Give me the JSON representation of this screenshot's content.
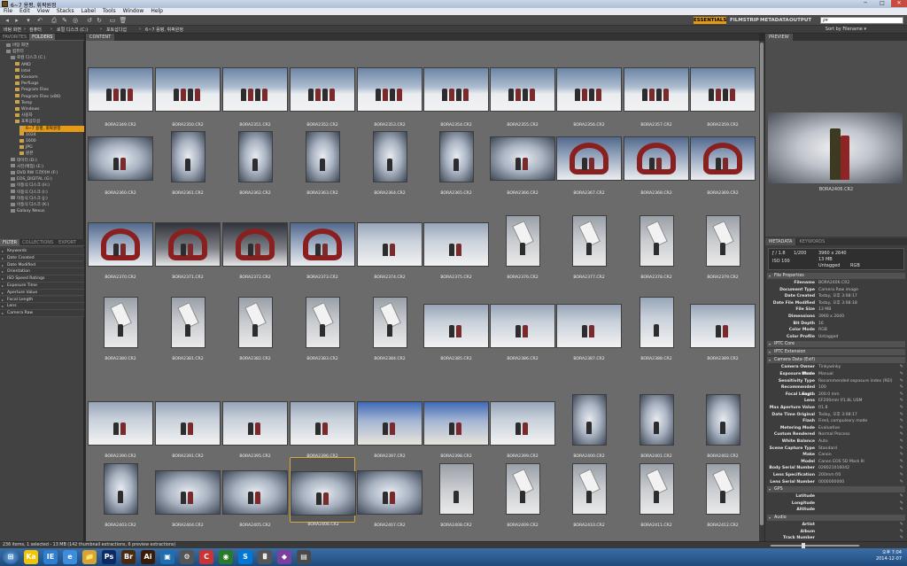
{
  "window": {
    "title": "6~7 용평, 휘팍원정",
    "controls": [
      "─",
      "□",
      "✕"
    ]
  },
  "menu": [
    "File",
    "Edit",
    "View",
    "Stacks",
    "Label",
    "Tools",
    "Window",
    "Help"
  ],
  "workspaces": [
    "ESSENTIALS",
    "FILMSTRIP",
    "METADATA",
    "OUTPUT"
  ],
  "search": {
    "placeholder": "ρ▾"
  },
  "path": [
    "바탕 화면",
    "컴퓨터",
    "로컬 디스크 (C:)",
    "포토삽다섭",
    "6~7 용평, 휘팍원정"
  ],
  "sort": "Sort by Filename ▾",
  "left_tabs": [
    "FAVORITES",
    "FOLDERS"
  ],
  "folders": [
    {
      "label": "바탕 화면",
      "indent": 1,
      "icon": "desktop"
    },
    {
      "label": "컴퓨터",
      "indent": 1,
      "icon": "drive"
    },
    {
      "label": "로컬 디스크 (C:)",
      "indent": 2,
      "icon": "drive"
    },
    {
      "label": "AMD",
      "indent": 3,
      "icon": "folder"
    },
    {
      "label": "Intel",
      "indent": 3,
      "icon": "folder"
    },
    {
      "label": "Kavoom",
      "indent": 3,
      "icon": "folder"
    },
    {
      "label": "PerfLogs",
      "indent": 3,
      "icon": "folder"
    },
    {
      "label": "Program Files",
      "indent": 3,
      "icon": "folder"
    },
    {
      "label": "Program Files (x86)",
      "indent": 3,
      "icon": "folder"
    },
    {
      "label": "Temp",
      "indent": 3,
      "icon": "folder"
    },
    {
      "label": "Windows",
      "indent": 3,
      "icon": "folder"
    },
    {
      "label": "사용자",
      "indent": 3,
      "icon": "folder"
    },
    {
      "label": "포토삽다섭",
      "indent": 3,
      "icon": "folder"
    },
    {
      "label": "6~7 용평, 휘팍원정",
      "indent": 4,
      "icon": "folder",
      "selected": true
    },
    {
      "label": "1024",
      "indent": 4,
      "icon": "folder"
    },
    {
      "label": "1600",
      "indent": 4,
      "icon": "folder"
    },
    {
      "label": "JPG",
      "indent": 4,
      "icon": "folder"
    },
    {
      "label": "원본",
      "indent": 4,
      "icon": "folder"
    },
    {
      "label": "데이터 (D:)",
      "indent": 2,
      "icon": "drive"
    },
    {
      "label": "사진(백업) (E:)",
      "indent": 2,
      "icon": "drive"
    },
    {
      "label": "DVD RW 드라이브 (F:)",
      "indent": 2,
      "icon": "drive"
    },
    {
      "label": "EOS_DIGITAL (G:)",
      "indent": 2,
      "icon": "drive"
    },
    {
      "label": "이동식 디스크 (H:)",
      "indent": 2,
      "icon": "drive"
    },
    {
      "label": "이동식 디스크 (I:)",
      "indent": 2,
      "icon": "drive"
    },
    {
      "label": "이동식 디스크 (J:)",
      "indent": 2,
      "icon": "drive"
    },
    {
      "label": "이동식 디스크 (K:)",
      "indent": 2,
      "icon": "drive"
    },
    {
      "label": "Galaxy Nexus",
      "indent": 2,
      "icon": "drive"
    }
  ],
  "filter_tabs": [
    "FILTER",
    "COLLECTIONS",
    "EXPORT"
  ],
  "filters": [
    "Keywords",
    "Date Created",
    "Date Modified",
    "Orientation",
    "ISO Speed Ratings",
    "Exposure Time",
    "Aperture Value",
    "Focal Length",
    "Lens",
    "Camera Raw"
  ],
  "content_tab": "CONTENT",
  "thumbnails": [
    {
      "name": "BORA2349.CR2",
      "o": "l",
      "s": "sky"
    },
    {
      "name": "BORA2350.CR2",
      "o": "l",
      "s": "sky"
    },
    {
      "name": "BORA2351.CR2",
      "o": "l",
      "s": "sky"
    },
    {
      "name": "BORA2352.CR2",
      "o": "l",
      "s": "sky"
    },
    {
      "name": "BORA2353.CR2",
      "o": "l",
      "s": "sky"
    },
    {
      "name": "BORA2354.CR2",
      "o": "l",
      "s": "sky"
    },
    {
      "name": "BORA2355.CR2",
      "o": "l",
      "s": "sky"
    },
    {
      "name": "BORA2356.CR2",
      "o": "l",
      "s": "sky"
    },
    {
      "name": "BORA2357.CR2",
      "o": "l",
      "s": "sky"
    },
    {
      "name": "BORA2359.CR2",
      "o": "l",
      "s": "sky"
    },
    {
      "name": "BORA2360.CR2",
      "o": "l",
      "s": "vig"
    },
    {
      "name": "BORA2361.CR2",
      "o": "p",
      "s": "vig"
    },
    {
      "name": "BORA2362.CR2",
      "o": "p",
      "s": "vig"
    },
    {
      "name": "BORA2363.CR2",
      "o": "p",
      "s": "vig"
    },
    {
      "name": "BORA2364.CR2",
      "o": "p",
      "s": "vig"
    },
    {
      "name": "BORA2365.CR2",
      "o": "p",
      "s": "vig"
    },
    {
      "name": "BORA2366.CR2",
      "o": "l",
      "s": "vig"
    },
    {
      "name": "BORA2367.CR2",
      "o": "l",
      "s": "red",
      "h": true
    },
    {
      "name": "BORA2368.CR2",
      "o": "l",
      "s": "red",
      "h": true
    },
    {
      "name": "BORA2369.CR2",
      "o": "l",
      "s": "red",
      "h": true
    },
    {
      "name": "BORA2370.CR2",
      "o": "l",
      "s": "red",
      "h": true
    },
    {
      "name": "BORA2371.CR2",
      "o": "l",
      "s": "dark",
      "h": true
    },
    {
      "name": "BORA2372.CR2",
      "o": "l",
      "s": "dark",
      "h": true
    },
    {
      "name": "BORA2373.CR2",
      "o": "l",
      "s": "red",
      "h": true
    },
    {
      "name": "BORA2374.CR2",
      "o": "l",
      "s": "snow"
    },
    {
      "name": "BORA2375.CR2",
      "o": "l",
      "s": "snow"
    },
    {
      "name": "BORA2376.CR2",
      "o": "p",
      "s": "grey",
      "c": true
    },
    {
      "name": "BORA2377.CR2",
      "o": "p",
      "s": "grey",
      "c": true
    },
    {
      "name": "BORA2378.CR2",
      "o": "p",
      "s": "grey",
      "c": true
    },
    {
      "name": "BORA2379.CR2",
      "o": "p",
      "s": "grey",
      "c": true
    },
    {
      "name": "BORA2380.CR2",
      "o": "p",
      "s": "grey",
      "c": true
    },
    {
      "name": "BORA2381.CR2",
      "o": "p",
      "s": "grey",
      "c": true
    },
    {
      "name": "BORA2382.CR2",
      "o": "p",
      "s": "grey",
      "c": true
    },
    {
      "name": "BORA2383.CR2",
      "o": "p",
      "s": "grey",
      "c": true
    },
    {
      "name": "BORA2384.CR2",
      "o": "p",
      "s": "grey",
      "c": true
    },
    {
      "name": "BORA2385.CR2",
      "o": "l",
      "s": "snow"
    },
    {
      "name": "BORA2386.CR2",
      "o": "l",
      "s": "snow"
    },
    {
      "name": "BORA2387.CR2",
      "o": "l",
      "s": "snow"
    },
    {
      "name": "BORA2388.CR2",
      "o": "p",
      "s": "snow"
    },
    {
      "name": "BORA2389.CR2",
      "o": "l",
      "s": "snow"
    },
    {
      "name": "BORA2390.CR2",
      "o": "l",
      "s": "snow"
    },
    {
      "name": "BORA2391.CR2",
      "o": "l",
      "s": "snow"
    },
    {
      "name": "BORA2395.CR2",
      "o": "l",
      "s": "snow"
    },
    {
      "name": "BORA2396.CR2",
      "o": "l",
      "s": "snow"
    },
    {
      "name": "BORA2397.CR2",
      "o": "l",
      "s": "bld"
    },
    {
      "name": "BORA2398.CR2",
      "o": "l",
      "s": "bld"
    },
    {
      "name": "BORA2399.CR2",
      "o": "l",
      "s": "snow"
    },
    {
      "name": "BORA2400.CR2",
      "o": "v",
      "s": "vig"
    },
    {
      "name": "BORA2401.CR2",
      "o": "v",
      "s": "vig"
    },
    {
      "name": "BORA2402.CR2",
      "o": "v",
      "s": "vig"
    },
    {
      "name": "BORA2403.CR2",
      "o": "v",
      "s": "vig"
    },
    {
      "name": "BORA2404.CR2",
      "o": "l",
      "s": "vig"
    },
    {
      "name": "BORA2405.CR2",
      "o": "l",
      "s": "vig"
    },
    {
      "name": "BORA2406.CR2",
      "o": "l",
      "s": "vig",
      "selected": true
    },
    {
      "name": "BORA2407.CR2",
      "o": "l",
      "s": "vig"
    },
    {
      "name": "BORA2408.CR2",
      "o": "p",
      "s": "grey"
    },
    {
      "name": "BORA2409.CR2",
      "o": "p",
      "s": "grey",
      "c": true
    },
    {
      "name": "BORA2410.CR2",
      "o": "p",
      "s": "grey",
      "c": true
    },
    {
      "name": "BORA2411.CR2",
      "o": "p",
      "s": "grey",
      "c": true
    },
    {
      "name": "BORA2412.CR2",
      "o": "p",
      "s": "grey",
      "c": true
    }
  ],
  "preview": {
    "tab": "PREVIEW",
    "caption": "BORA2406.CR2"
  },
  "meta_tabs": [
    "METADATA",
    "KEYWORDS"
  ],
  "camera_box": {
    "aperture": "ƒ / 1.8",
    "shutter": "1/200",
    "dimensions": "3960 x 2640",
    "size": "13 MB",
    "label": "Untagged",
    "color_mode": "RGB",
    "iso": "ISO 100"
  },
  "metadata_sections": [
    {
      "title": "File Properties",
      "rows": [
        [
          "Filename",
          "BORA2406.CR2"
        ],
        [
          "Document Type",
          "Camera Raw image"
        ],
        [
          "Date Created",
          "Today, 오후 3:08:17"
        ],
        [
          "Date File Modified",
          "Today, 오후 3:08:18"
        ],
        [
          "File Size",
          "13 MB"
        ],
        [
          "Dimensions",
          "3960 x 2640"
        ],
        [
          "Bit Depth",
          "16"
        ],
        [
          "Color Mode",
          "RGB"
        ],
        [
          "Color Profile",
          "Untagged"
        ]
      ]
    },
    {
      "title": "IPTC Core",
      "rows": []
    },
    {
      "title": "IPTC Extension",
      "rows": []
    },
    {
      "title": "Camera Data (Exif)",
      "rows": [
        [
          "Camera Owner Name",
          "Tinkywinky"
        ],
        [
          "Exposure Mode",
          "Manual"
        ],
        [
          "Sensitivity Type",
          "Recommended exposure index (REI)"
        ],
        [
          "Recommended Exp...",
          "100"
        ],
        [
          "Focal Length",
          "200.0 mm"
        ],
        [
          "Lens",
          "EF200mm f/1.8L USM"
        ],
        [
          "Max Aperture Value",
          "f/1.8"
        ],
        [
          "Date Time Original",
          "Today, 오후 3:08:17"
        ],
        [
          "Flash",
          "Fired, compulsory mode"
        ],
        [
          "Metering Mode",
          "Evaluative"
        ],
        [
          "Custom Rendered",
          "Normal Process"
        ],
        [
          "White Balance",
          "Auto"
        ],
        [
          "Scene Capture Type",
          "Standard"
        ],
        [
          "Make",
          "Canon"
        ],
        [
          "Model",
          "Canon EOS 5D Mark III"
        ],
        [
          "Body Serial Number",
          "028021016042"
        ],
        [
          "Lens Specification",
          "200mm f/0"
        ],
        [
          "Lens Serial Number",
          "0000000000"
        ]
      ]
    },
    {
      "title": "GPS",
      "rows": [
        [
          "Latitude",
          ""
        ],
        [
          "Longitude",
          ""
        ],
        [
          "Altitude",
          ""
        ]
      ]
    },
    {
      "title": "Audio",
      "rows": [
        [
          "Artist",
          ""
        ],
        [
          "Album",
          ""
        ],
        [
          "Track Number",
          ""
        ]
      ]
    }
  ],
  "status": "236 items, 1 selected - 13 MB (142 thumbnail extractions, 6 preview extractions)",
  "taskbar": {
    "apps": [
      "Ka",
      "IE",
      "e",
      "📁",
      "Ps",
      "Br",
      "Ai",
      "▣",
      "⚙",
      "C",
      "◉",
      "S",
      "🖩",
      "◆",
      "▤"
    ],
    "clock_time": "오후 7:04",
    "clock_date": "2014-12-07"
  }
}
